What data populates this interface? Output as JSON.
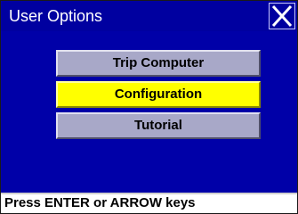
{
  "window": {
    "title": "User Options",
    "close_icon": "close-x-icon"
  },
  "menu": {
    "items": [
      {
        "label": "Trip Computer",
        "selected": false
      },
      {
        "label": "Configuration",
        "selected": true
      },
      {
        "label": "Tutorial",
        "selected": false
      }
    ]
  },
  "status": {
    "text": "Press ENTER or ARROW keys"
  },
  "colors": {
    "background": "#0000a8",
    "button": "#a8a8c8",
    "selected": "#ffff00",
    "status_bar": "#ffffff"
  }
}
